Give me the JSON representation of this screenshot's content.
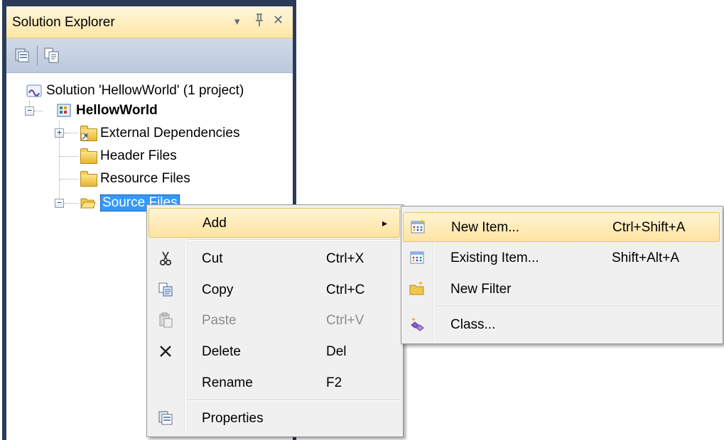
{
  "panel": {
    "title": "Solution Explorer",
    "controls": {
      "dropdown": "▾",
      "pin": "ᵖ",
      "close": "✕"
    }
  },
  "tree": {
    "solution": "Solution 'HellowWorld' (1 project)",
    "project": "HellowWorld",
    "items": [
      {
        "label": "External Dependencies"
      },
      {
        "label": "Header Files"
      },
      {
        "label": "Resource Files"
      },
      {
        "label": "Source Files"
      }
    ]
  },
  "context_menu": {
    "items": [
      {
        "label": "Add",
        "shortcut": "",
        "submenu_arrow": "▸"
      },
      {
        "label": "Cut",
        "shortcut": "Ctrl+X"
      },
      {
        "label": "Copy",
        "shortcut": "Ctrl+C"
      },
      {
        "label": "Paste",
        "shortcut": "Ctrl+V",
        "disabled": true
      },
      {
        "label": "Delete",
        "shortcut": "Del"
      },
      {
        "label": "Rename",
        "shortcut": "F2"
      },
      {
        "label": "Properties",
        "shortcut": ""
      }
    ]
  },
  "submenu": {
    "items": [
      {
        "label": "New Item...",
        "shortcut": "Ctrl+Shift+A"
      },
      {
        "label": "Existing Item...",
        "shortcut": "Shift+Alt+A"
      },
      {
        "label": "New Filter",
        "shortcut": ""
      },
      {
        "label": "Class...",
        "shortcut": ""
      }
    ]
  },
  "colors": {
    "title_gradient_top": "#fff6dc",
    "title_gradient_bottom": "#ffe6a6",
    "frame": "#2b3c59",
    "selection": "#3399ff",
    "menu_bg": "#f0f0f0",
    "menu_hover": "#ffe3a0"
  }
}
